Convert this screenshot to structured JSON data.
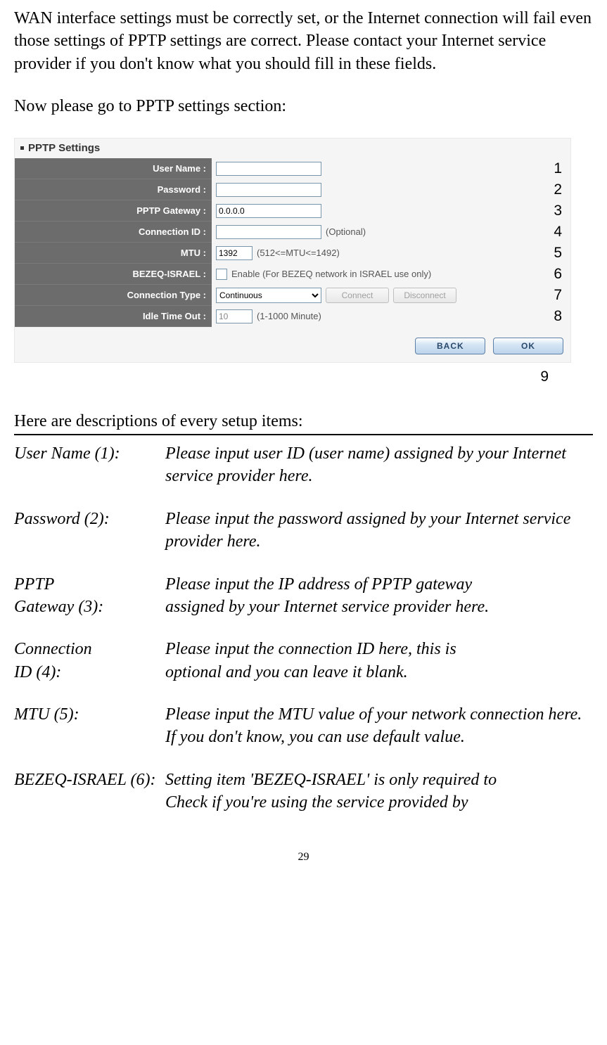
{
  "intro_para": "WAN interface settings must be correctly set, or the Internet connection will fail even those settings of PPTP settings are correct. Please contact your Internet service provider if you don't know what you should fill in these fields.",
  "goto_para": "Now please go to PPTP settings section:",
  "pptp": {
    "header": "PPTP Settings",
    "rows": {
      "user_name_label": "User Name :",
      "password_label": "Password :",
      "gateway_label": "PPTP Gateway :",
      "gateway_value": "0.0.0.0",
      "conn_id_label": "Connection ID :",
      "conn_id_hint": "(Optional)",
      "mtu_label": "MTU :",
      "mtu_value": "1392",
      "mtu_hint": "(512<=MTU<=1492)",
      "bezeq_label": "BEZEQ-ISRAEL :",
      "bezeq_hint": "Enable (For BEZEQ network in ISRAEL use only)",
      "conn_type_label": "Connection Type :",
      "conn_type_value": "Continuous",
      "connect_btn": "Connect",
      "disconnect_btn": "Disconnect",
      "idle_label": "Idle Time Out :",
      "idle_value": "10",
      "idle_hint": "(1-1000 Minute)"
    },
    "back_btn": "BACK",
    "ok_btn": "OK"
  },
  "anno": {
    "a1": "1",
    "a2": "2",
    "a3": "3",
    "a4": "4",
    "a5": "5",
    "a6": "6",
    "a7": "7",
    "a8": "8",
    "a9": "9"
  },
  "desc_intro": "Here are descriptions of every setup items:",
  "desc": {
    "d1l": "User Name (1):",
    "d1t": "Please input user ID (user name) assigned by your Internet service provider here.",
    "d2l": "Password (2):",
    "d2t": "Please input the password assigned by your Internet service provider here.",
    "d3la": "PPTP",
    "d3lb": "Gateway (3):",
    "d3ta": "Please input the IP address of PPTP gateway",
    "d3tb": "assigned by your Internet service provider here.",
    "d4la": "Connection",
    "d4lb": "ID (4):",
    "d4ta": "Please input the connection ID here, this is",
    "d4tb": "optional and you can leave it blank.",
    "d5l": "MTU (5):",
    "d5t": "Please input the MTU value of your network connection here. If you don't know, you can use default value.",
    "d6l": "BEZEQ-ISRAEL (6):",
    "d6ta": "Setting item 'BEZEQ-ISRAEL' is only required to",
    "d6tb": "Check if you're using the service provided by"
  },
  "page_num": "29"
}
